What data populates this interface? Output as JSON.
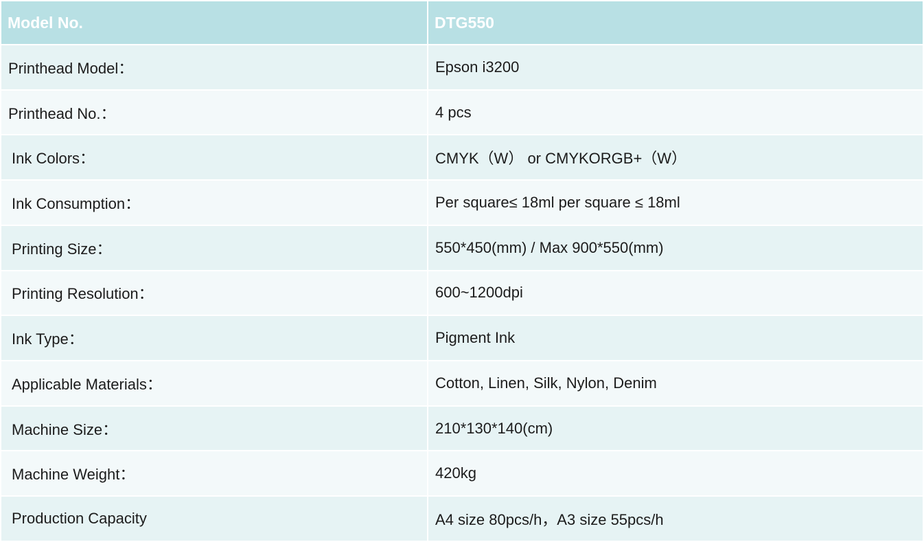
{
  "header": {
    "label": "Model No.",
    "value": "DTG550"
  },
  "rows": [
    {
      "label": "Printhead Model：",
      "value": "Epson i3200"
    },
    {
      "label": "Printhead No.：",
      "value": "4 pcs"
    },
    {
      "label": "Ink Colors：",
      "value": "CMYK（W） or  CMYKORGB+（W）"
    },
    {
      "label": "Ink Consumption：",
      "value": "Per square≤ 18ml per square ≤ 18ml"
    },
    {
      "label": "Printing Size：",
      "value": "550*450(mm) / Max 900*550(mm)"
    },
    {
      "label": "Printing Resolution：",
      "value": "600~1200dpi"
    },
    {
      "label": "Ink Type：",
      "value": " Pigment Ink"
    },
    {
      "label": "Applicable Materials：",
      "value": "Cotton, Linen, Silk, Nylon, Denim"
    },
    {
      "label": "Machine Size：",
      "value": "210*130*140(cm)"
    },
    {
      "label": "Machine Weight：",
      "value": "420kg"
    },
    {
      "label": "Production Capacity",
      "value": "A4 size 80pcs/h，A3 size 55pcs/h"
    }
  ],
  "colors": {
    "header_bg": "#b8e0e4",
    "header_text": "#ffffff",
    "row_bg_odd": "#e6f3f4",
    "row_bg_even": "#f3f9fa",
    "text": "#1c1c1c"
  }
}
